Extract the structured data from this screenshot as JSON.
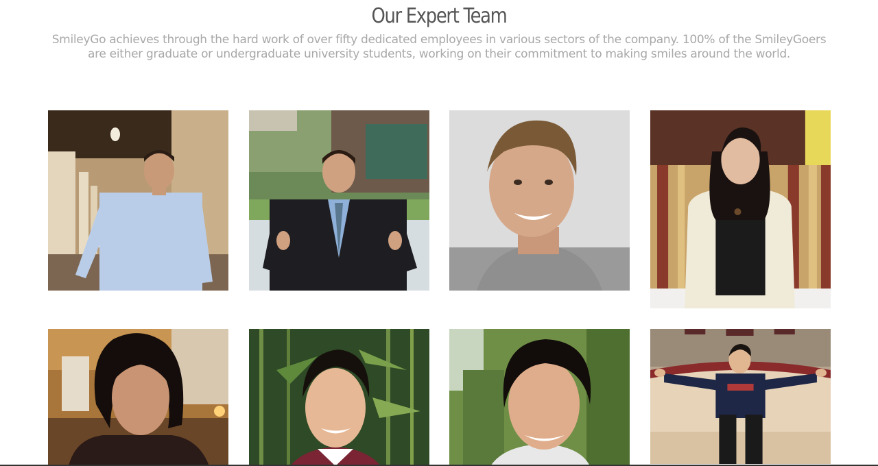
{
  "section": {
    "title": "Our Expert Team",
    "description": "SmileyGo achieves through the hard work of over fifty dedicated employees in various sectors of the company. 100% of the SmileyGoers are either graduate or undergraduate university students, working on their commitment to making smiles around the world."
  },
  "team": [
    {
      "photo": "team-photo-1",
      "scene": "arcade-corridor",
      "colors": {
        "bg": "#b89a74",
        "shirt": "#b9cde8",
        "skin": "#c99a78",
        "hair": "#2b1d14"
      }
    },
    {
      "photo": "team-photo-2",
      "scene": "campus-building",
      "colors": {
        "bg": "#5f7d4e",
        "shirt": "#1e1e22",
        "skin": "#d0a181",
        "hair": "#2a1c12"
      }
    },
    {
      "photo": "team-photo-3",
      "scene": "white-wall",
      "colors": {
        "bg": "#dcdcdc",
        "shirt": "#9a9a9a",
        "skin": "#d6a88a",
        "hair": "#7a5a36"
      }
    },
    {
      "photo": "team-photo-4",
      "scene": "striped-booth",
      "colors": {
        "bg": "#8a4a34",
        "shirt": "#1b1b1b",
        "skin": "#e2bca0",
        "hair": "#1a1210"
      }
    },
    {
      "photo": "team-photo-5",
      "scene": "restaurant",
      "colors": {
        "bg": "#a8753a",
        "shirt": "#2a1a18",
        "skin": "#c89474",
        "hair": "#140d0b"
      }
    },
    {
      "photo": "team-photo-6",
      "scene": "bamboo",
      "colors": {
        "bg": "#2f4a26",
        "shirt": "#ffffff",
        "skin": "#e6b895",
        "hair": "#16100c"
      }
    },
    {
      "photo": "team-photo-7",
      "scene": "trees",
      "colors": {
        "bg": "#6f8f46",
        "shirt": "#e8e8e8",
        "skin": "#e0ad8c",
        "hair": "#120d0a"
      }
    },
    {
      "photo": "team-photo-8",
      "scene": "lounge-sofa",
      "colors": {
        "bg": "#b7a58f",
        "shirt": "#1f2747",
        "skin": "#e1b792",
        "hair": "#1a1410"
      }
    }
  ]
}
